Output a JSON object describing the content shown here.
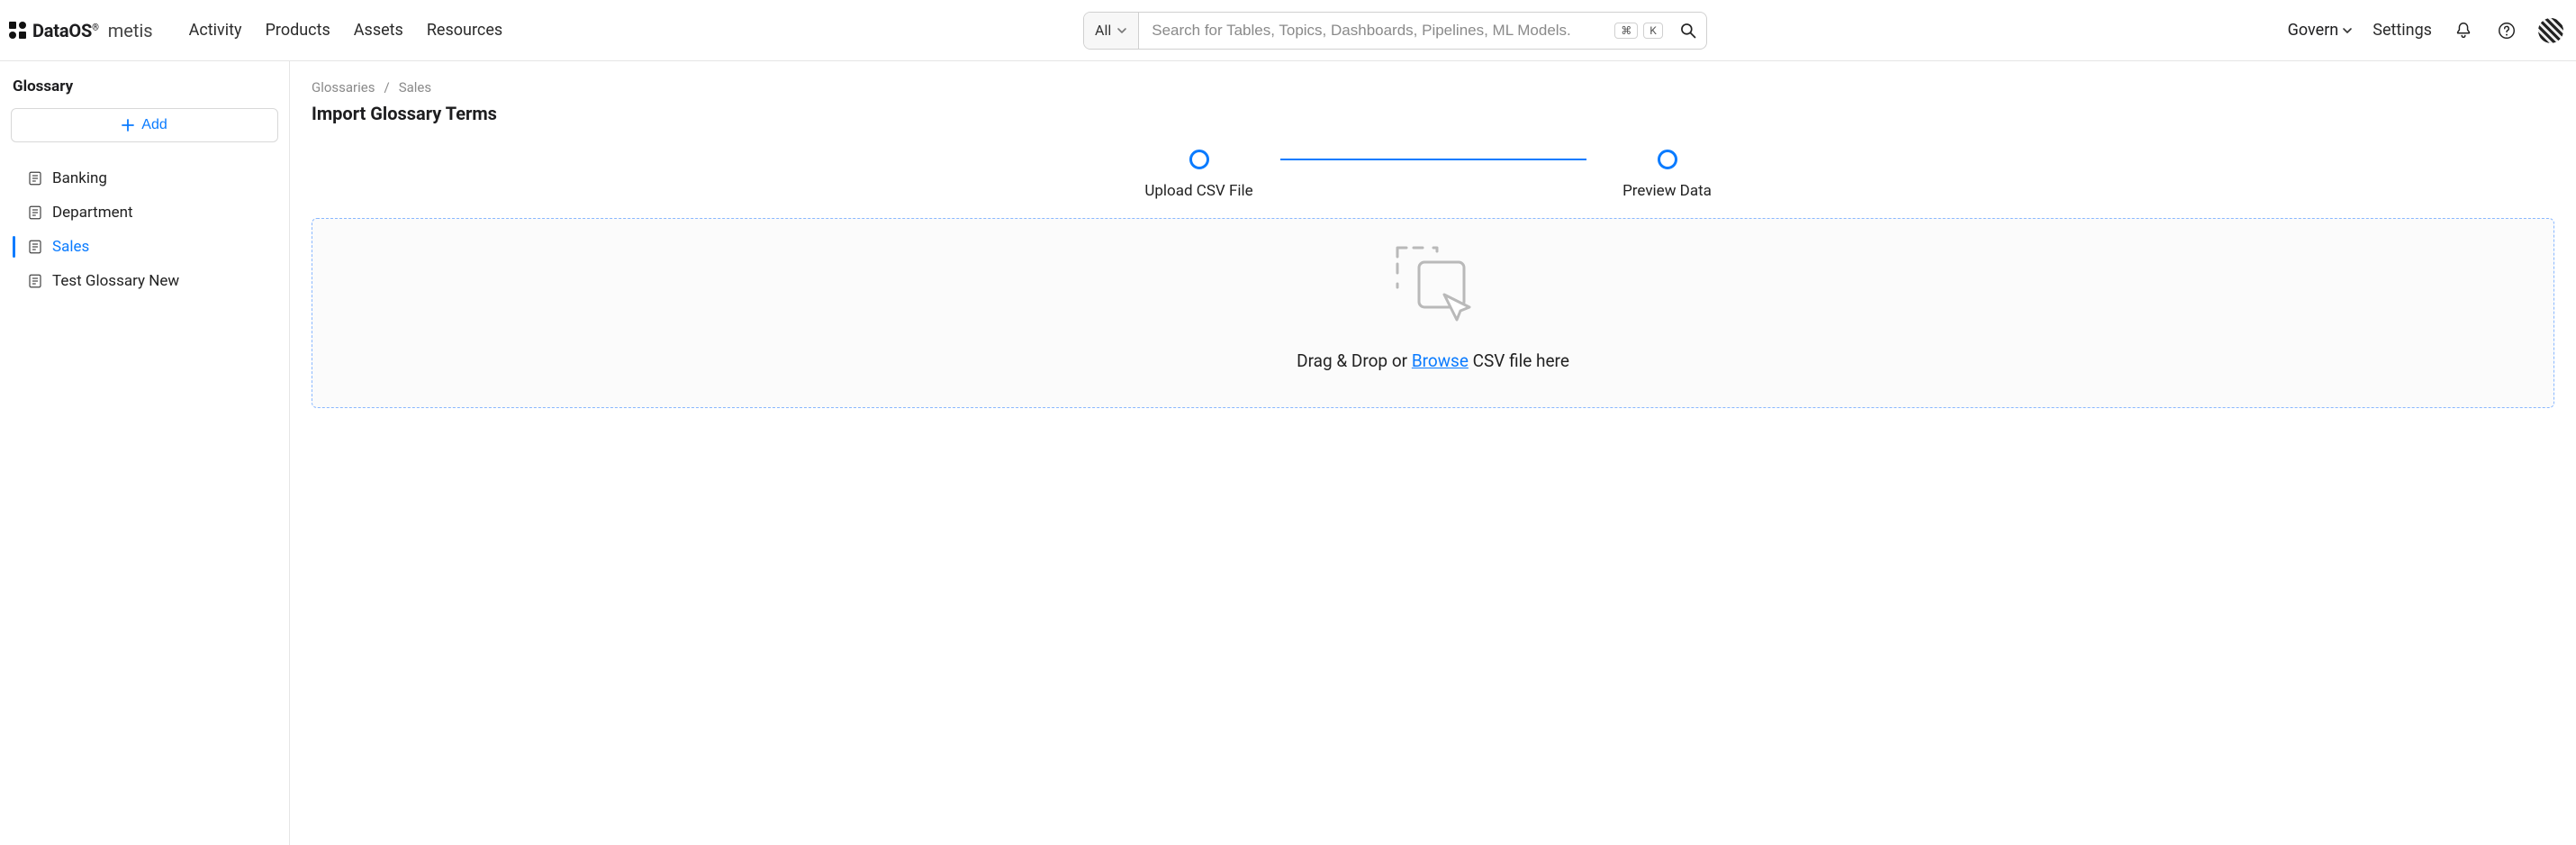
{
  "brand": {
    "name": "DataOS",
    "registered": "®",
    "module": "metis"
  },
  "nav": {
    "activity": "Activity",
    "products": "Products",
    "assets": "Assets",
    "resources": "Resources"
  },
  "search": {
    "scope": "All",
    "placeholder": "Search for Tables, Topics, Dashboards, Pipelines, ML Models.",
    "kbd_cmd": "⌘",
    "kbd_key": "K"
  },
  "topright": {
    "govern": "Govern",
    "settings": "Settings"
  },
  "sidebar": {
    "title": "Glossary",
    "add_label": "Add",
    "items": [
      {
        "label": "Banking",
        "active": false
      },
      {
        "label": "Department",
        "active": false
      },
      {
        "label": "Sales",
        "active": true
      },
      {
        "label": "Test Glossary New",
        "active": false
      }
    ]
  },
  "breadcrumbs": {
    "root": "Glossaries",
    "sep": "/",
    "current": "Sales"
  },
  "page": {
    "title": "Import Glossary Terms"
  },
  "stepper": {
    "step1": "Upload CSV File",
    "step2": "Preview Data"
  },
  "dropzone": {
    "prefix": "Drag & Drop or ",
    "browse": "Browse",
    "suffix": " CSV file here"
  }
}
